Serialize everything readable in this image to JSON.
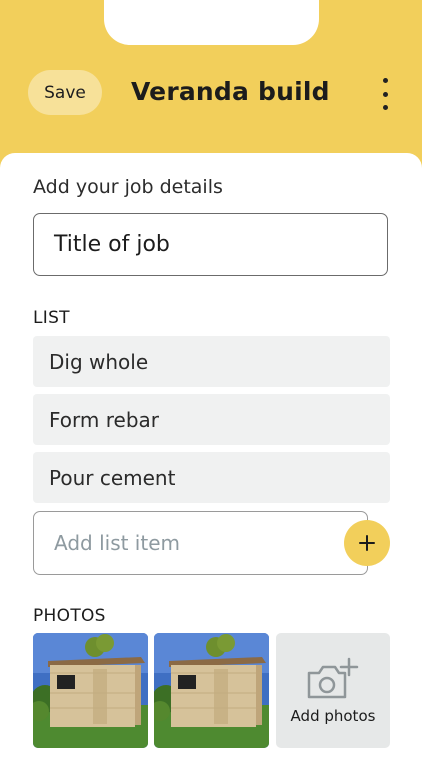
{
  "header": {
    "save_label": "Save",
    "title": "Veranda build",
    "more_icon": "more-vertical-icon"
  },
  "form": {
    "details_label": "Add your job details",
    "title_value": "Title of job"
  },
  "list": {
    "heading": "LIST",
    "items": [
      {
        "label": "Dig whole"
      },
      {
        "label": "Form rebar"
      },
      {
        "label": "Pour cement"
      }
    ],
    "add_placeholder": "Add list item",
    "add_icon": "plus-icon"
  },
  "photos": {
    "heading": "PHOTOS",
    "add_label": "Add photos",
    "add_icon": "camera-plus-icon"
  },
  "colors": {
    "accent": "#F2CF5B",
    "save_button": "#F7E199",
    "list_item_bg": "#F0F1F1"
  }
}
